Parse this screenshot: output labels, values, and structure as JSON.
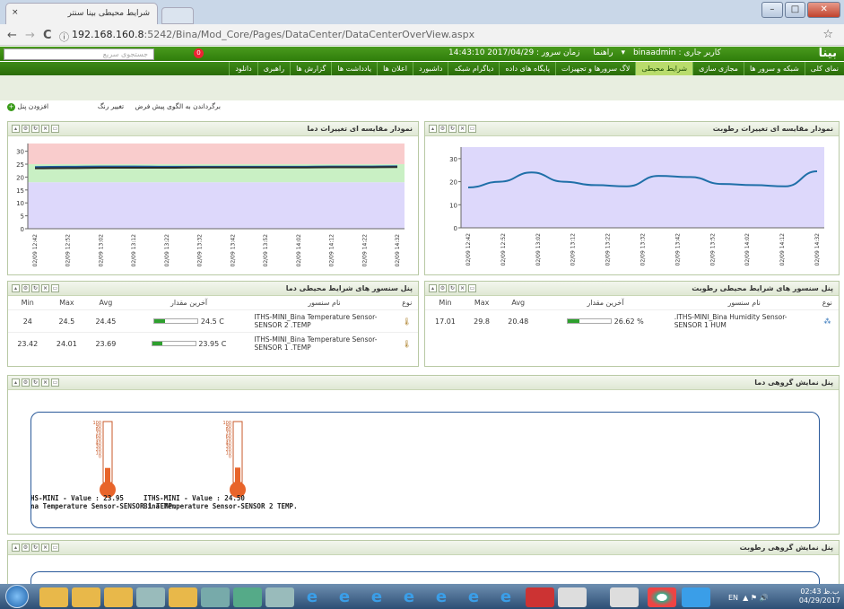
{
  "browser": {
    "tab_title": "شرایط محیطی بینا سنتر",
    "tab_close": "×",
    "url_host": "192.168.160.8",
    "url_path": ":5242/Bina/Mod_Core/Pages/DataCenter/DataCenterOverView.aspx",
    "back": "←",
    "forward": "→",
    "reload": "C",
    "info": "ⓘ",
    "star": "☆",
    "win_min": "–",
    "win_max": "□",
    "win_close": "✕"
  },
  "header": {
    "search_placeholder": "جستجوی سریع",
    "notif_count": "0",
    "user_label": "کاربر جاری : binaadmin",
    "help": "راهنما",
    "server_time": "زمان سرور : 2017/04/29 14:43:10",
    "logo": "بینا"
  },
  "menu": [
    {
      "label": "نمای کلی"
    },
    {
      "label": "شبکه و سرور ها"
    },
    {
      "label": "مجازی سازی"
    },
    {
      "label": "شرایط محیطی",
      "active": true
    },
    {
      "label": "لاگ سرورها و تجهیزات"
    },
    {
      "label": "پایگاه های داده"
    },
    {
      "label": "دیاگرام شبکه"
    },
    {
      "label": "داشبورد"
    },
    {
      "label": "اعلان ها"
    },
    {
      "label": "یادداشت ها"
    },
    {
      "label": "گزارش ها"
    },
    {
      "label": "راهبری"
    },
    {
      "label": "دانلود"
    }
  ],
  "toolbar": {
    "add_panel": "افزودن پنل",
    "change_color": "تغییر رنگ",
    "reset_layout": "برگرداندن به الگوی پیش فرض"
  },
  "panels": {
    "humidity_chart": {
      "title": "نمودار مقایسه ای تغییرات رطوبت"
    },
    "temp_chart": {
      "title": "نمودار مقایسه ای تغییرات دما"
    },
    "humidity_sensors": {
      "title": "پنل سنسور های شرایط محیطی رطوبت",
      "cols": {
        "type": "نوع",
        "name": "نام سنسور",
        "last": "آخرین مقدار",
        "avg": "Avg",
        "max": "Max",
        "min": "Min"
      },
      "rows": [
        {
          "name": ".ITHS-MINI_Bina Humidity Sensor-SENSOR 1 HUM",
          "last": "26.62 %",
          "fill": 0.27,
          "avg": "20.48",
          "max": "29.8",
          "min": "17.01"
        }
      ]
    },
    "temp_sensors": {
      "title": "پنل سنسور های شرایط محیطی دما",
      "cols": {
        "type": "نوع",
        "name": "نام سنسور",
        "last": "آخرین مقدار",
        "avg": "Avg",
        "max": "Max",
        "min": "Min"
      },
      "rows": [
        {
          "name": "ITHS-MINI_Bina Temperature Sensor-SENSOR 2 .TEMP",
          "last": "24.5 C",
          "fill": 0.25,
          "avg": "24.45",
          "max": "24.5",
          "min": "24"
        },
        {
          "name": "ITHS-MINI_Bina Temperature Sensor-SENSOR 1 .TEMP",
          "last": "23.95 C",
          "fill": 0.24,
          "avg": "23.69",
          "max": "24.01",
          "min": "23.42"
        }
      ]
    },
    "temp_group": {
      "title": "پنل نمایش گروهی دما",
      "thermos": [
        {
          "value_label": "ITHS-MINI - Value : 23.95",
          "name": "Bina Temperature Sensor-SENSOR 1 TEMP.",
          "level": 23.95
        },
        {
          "value_label": "ITHS-MINI - Value : 24.50",
          "name": "Bina Temperature Sensor-SENSOR 2 TEMP.",
          "level": 24.5
        }
      ],
      "scale": [
        "100",
        "90",
        "80",
        "70",
        "60",
        "50",
        "40",
        "30",
        "20",
        "10",
        "0"
      ]
    },
    "humidity_group": {
      "title": "پنل نمایش گروهی رطوبت"
    }
  },
  "chart_data": [
    {
      "type": "line",
      "title": "نمودار مقایسه ای تغییرات رطوبت",
      "categories": [
        "02/09 12:42",
        "02/09 12:52",
        "02/09 13:02",
        "02/09 13:12",
        "02/09 13:22",
        "02/09 13:32",
        "02/09 13:42",
        "02/09 13:52",
        "02/09 14:02",
        "02/09 14:12",
        "02/09 14:32"
      ],
      "series": [
        {
          "values": [
            17.5,
            20,
            24,
            20,
            18.5,
            18,
            22.5,
            22,
            19,
            18.5,
            18,
            24.5
          ]
        }
      ],
      "yticks": [
        0,
        10,
        20,
        30
      ],
      "ylim": [
        0,
        35
      ],
      "color": "#1f6fa8",
      "background": "#ddd8fb"
    },
    {
      "type": "line",
      "title": "نمودار مقایسه ای تغییرات دما",
      "categories": [
        "02/09 12:42",
        "02/09 12:52",
        "02/09 13:02",
        "02/09 13:12",
        "02/09 13:22",
        "02/09 13:32",
        "02/09 13:42",
        "02/09 13:52",
        "02/09 14:02",
        "02/09 14:12",
        "02/09 14:22",
        "02/09 14:32"
      ],
      "series": [
        {
          "values": [
            23.9,
            24,
            24.1,
            24.1,
            24,
            24,
            24,
            24,
            24,
            24.1,
            24.1,
            24.2
          ]
        },
        {
          "values": [
            23.4,
            23.5,
            23.6,
            23.6,
            23.6,
            23.7,
            23.7,
            23.7,
            23.7,
            23.8,
            23.8,
            23.9
          ]
        }
      ],
      "yticks": [
        0,
        5,
        10,
        15,
        20,
        25,
        30
      ],
      "ylim": [
        0,
        33
      ],
      "bands": [
        {
          "from": 0,
          "to": 18,
          "color": "#ddd8fb"
        },
        {
          "from": 18,
          "to": 25,
          "color": "#c9f0c4"
        },
        {
          "from": 25,
          "to": 33,
          "color": "#f9cccc"
        }
      ],
      "colors": [
        "#1f5fa0",
        "#2a2a2a"
      ]
    }
  ],
  "taskbar": {
    "lang": "EN",
    "time": "02:43 ب.ظ",
    "date": "04/29/2017"
  }
}
